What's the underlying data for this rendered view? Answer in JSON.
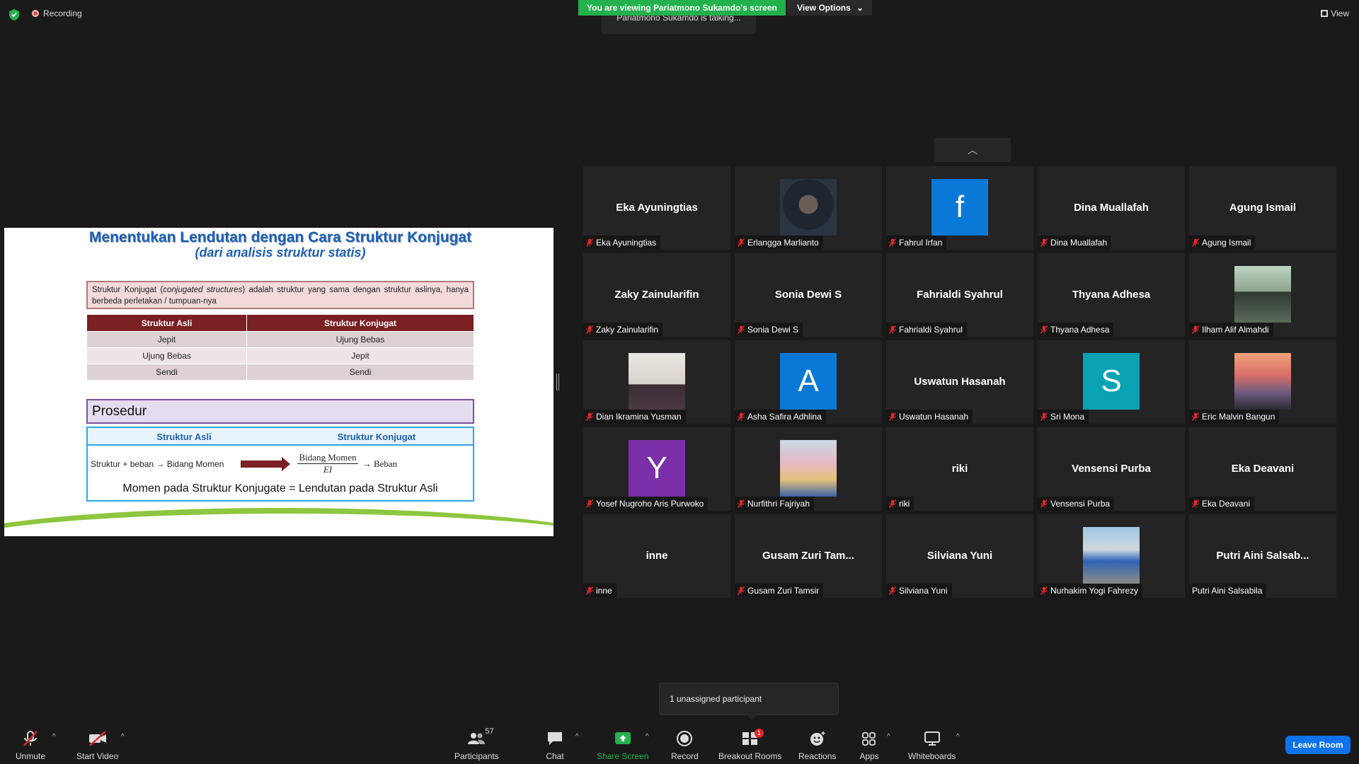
{
  "top": {
    "recording_label": "Recording",
    "viewing_banner": "You are viewing Pariatmono Sukamdo's screen",
    "view_options_label": "View Options",
    "talking_label": "Pariatmono Sukamdo is talking...",
    "view_label": "View"
  },
  "slide": {
    "title": "Menentukan Lendutan dengan Cara Struktur Konjugat",
    "subtitle": "(dari analisis struktur statis)",
    "definition_prefix": "Struktur Konjugat (",
    "definition_italic": "conjugated structures",
    "definition_suffix": ") adalah struktur yang sama dengan struktur aslinya, hanya berbeda perletakan / tumpuan-nya",
    "table_headers": [
      "Struktur Asli",
      "Struktur Konjugat"
    ],
    "table_rows": [
      [
        "Jepit",
        "Ujung Bebas"
      ],
      [
        "Ujung Bebas",
        "Jepit"
      ],
      [
        "Sendi",
        "Sendi"
      ]
    ],
    "prosedur_label": "Prosedur",
    "proc_headers": [
      "Struktur Asli",
      "Struktur Konjugat"
    ],
    "proc_left": "Struktur + beban → Bidang Momen",
    "frac_num": "Bidang Momen",
    "frac_den": "EI",
    "proc_right": "→ Beban",
    "momen_line": "Momen pada Struktur Konjugate = Lendutan pada Struktur Asli"
  },
  "participants": [
    {
      "name": "Eka Ayuningtias",
      "display": "name"
    },
    {
      "name": "Erlangga Marlianto",
      "display": "photo",
      "photo": "dark"
    },
    {
      "name": "Fahrul Irfan",
      "display": "avatar",
      "letter": "f",
      "color": "#0a78d7"
    },
    {
      "name": "Dina Muallafah",
      "display": "name"
    },
    {
      "name": "Agung Ismail",
      "display": "name"
    },
    {
      "name": "Zaky Zainularifin",
      "display": "name"
    },
    {
      "name": "Sonia Dewi S",
      "display": "name"
    },
    {
      "name": "Fahrialdi Syahrul",
      "display": "name"
    },
    {
      "name": "Thyana Adhesa",
      "display": "name"
    },
    {
      "name": "Ilham Alif Almahdi",
      "display": "photo",
      "photo": "outdoor"
    },
    {
      "name": "Dian Ikramina Yusman",
      "display": "photo",
      "photo": "person"
    },
    {
      "name": "Asha Safira Adhlina",
      "display": "avatar",
      "letter": "A",
      "color": "#0a78d7"
    },
    {
      "name": "Uswatun Hasanah",
      "display": "name"
    },
    {
      "name": "Sri Mona",
      "display": "avatar",
      "letter": "S",
      "color": "#0aa3b3"
    },
    {
      "name": "Eric Malvin Bangun",
      "display": "photo",
      "photo": "sunset"
    },
    {
      "name": "Yosef Nugroho Aris Purwoko",
      "display": "avatar",
      "letter": "Y",
      "color": "#7b2fa8"
    },
    {
      "name": "Nurfithri Fajriyah",
      "display": "photo",
      "photo": "group"
    },
    {
      "name": "riki",
      "display": "name"
    },
    {
      "name": "Vensensi Purba",
      "display": "name"
    },
    {
      "name": "Eka Deavani",
      "display": "name"
    },
    {
      "name": "inne",
      "display": "name"
    },
    {
      "name": "Gusam Zuri Tamsir",
      "display": "name",
      "short": "Gusam Zuri Tam..."
    },
    {
      "name": "Silviana Yuni",
      "display": "name"
    },
    {
      "name": "Nurhakim Yogi Fahrezy",
      "display": "photo",
      "photo": "worker"
    },
    {
      "name": "Putri Aini Salsabila",
      "display": "name",
      "short": "Putri  Aini  Salsab...",
      "nomic": true
    }
  ],
  "tooltip": "1 unassigned participant",
  "toolbar": {
    "unmute": "Unmute",
    "start_video": "Start Video",
    "participants": "Participants",
    "participants_count": "57",
    "chat": "Chat",
    "share_screen": "Share Screen",
    "record": "Record",
    "breakout_rooms": "Breakout Rooms",
    "breakout_badge": "1",
    "reactions": "Reactions",
    "apps": "Apps",
    "whiteboards": "Whiteboards",
    "leave": "Leave Room"
  },
  "colors": {
    "share_green": "#23b14d",
    "leave_blue": "#0e72ed",
    "mic_red": "#e02828"
  }
}
